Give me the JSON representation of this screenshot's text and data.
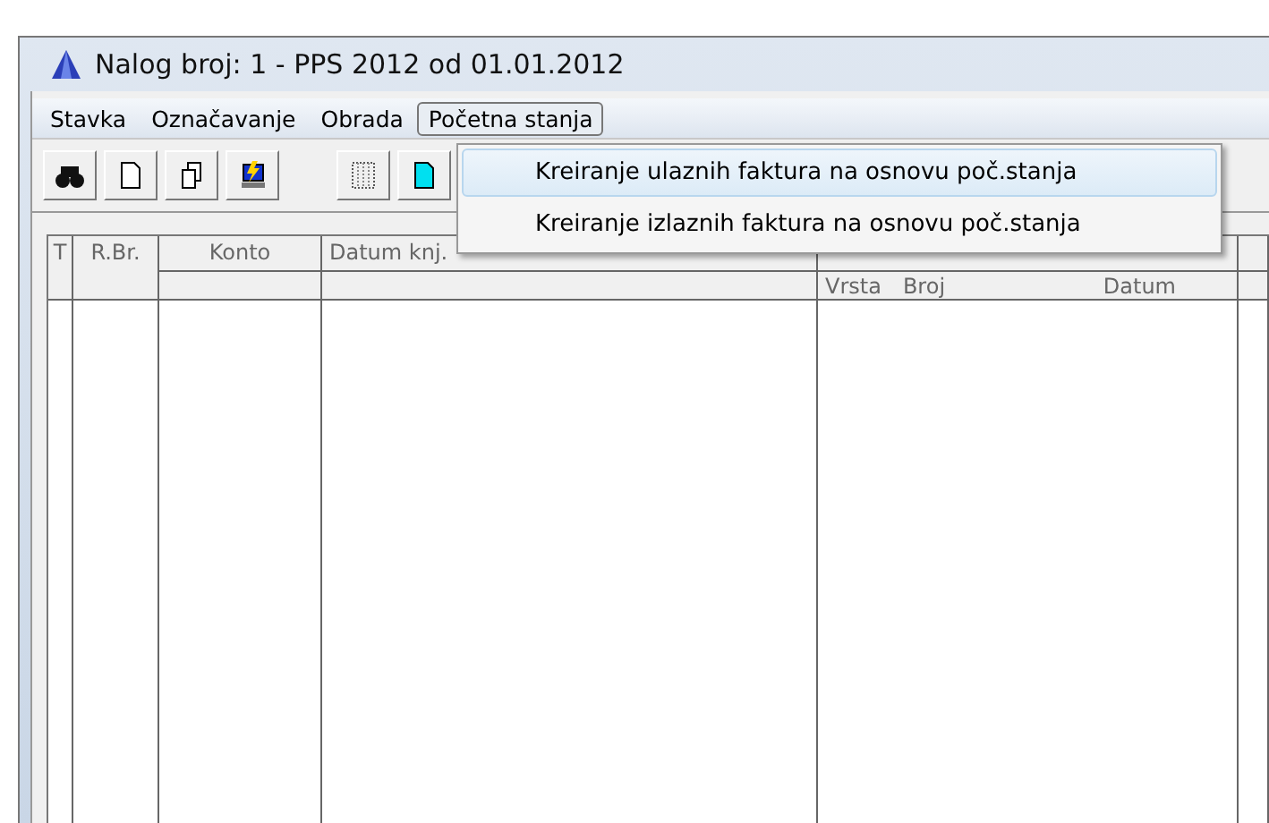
{
  "window": {
    "title": "Nalog broj: 1 - PPS 2012 od 01.01.2012"
  },
  "menu_bar": [
    {
      "label": "Stavka",
      "selected": false
    },
    {
      "label": "Označavanje",
      "selected": false
    },
    {
      "label": "Obrada",
      "selected": false
    },
    {
      "label": "Početna stanja",
      "selected": true
    }
  ],
  "dropdown": [
    {
      "label": "Kreiranje ulaznih faktura na osnovu poč.stanja",
      "selected": true
    },
    {
      "label": "Kreiranje izlaznih faktura na osnovu poč.stanja",
      "selected": false
    }
  ],
  "table": {
    "columns": [
      "T",
      "R.Br.",
      "Konto",
      "Datum knj."
    ],
    "document_subcolumns": [
      "Vrsta",
      "Broj",
      "Datum"
    ]
  }
}
